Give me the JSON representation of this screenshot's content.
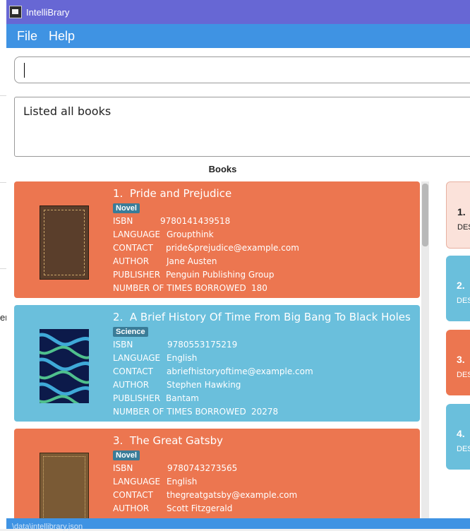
{
  "window": {
    "title": "IntelliBrary"
  },
  "menu": {
    "file": "File",
    "help": "Help"
  },
  "command": {
    "value": "",
    "placeholder": ""
  },
  "result": {
    "text": "Listed all books"
  },
  "books_panel": {
    "header": "Books"
  },
  "underlay": {
    "fragment": "er"
  },
  "books": [
    {
      "index": "1.",
      "title": "Pride and Prejudice",
      "tag": "Novel",
      "card_color": "#ec7650",
      "fields": [
        {
          "label": "ISBN",
          "value": "9780141439518"
        },
        {
          "label": "LANGUAGE",
          "value": "Groupthink"
        },
        {
          "label": "CONTACT",
          "value": "pride&prejudice@example.com"
        },
        {
          "label": "AUTHOR",
          "value": "Jane Austen"
        },
        {
          "label": "PUBLISHER",
          "value": "Penguin Publishing Group"
        },
        {
          "label": "NUMBER OF TIMES BORROWED",
          "value": "180"
        }
      ]
    },
    {
      "index": "2.",
      "title": "A Brief History Of Time From Big Bang To Black Holes",
      "tag": "Science",
      "card_color": "#6abfdc",
      "fields": [
        {
          "label": "ISBN",
          "value": "9780553175219"
        },
        {
          "label": "LANGUAGE",
          "value": "English"
        },
        {
          "label": "CONTACT",
          "value": "abriefhistoryoftime@example.com"
        },
        {
          "label": "AUTHOR",
          "value": "Stephen Hawking"
        },
        {
          "label": "PUBLISHER",
          "value": "Bantam"
        },
        {
          "label": "NUMBER OF TIMES BORROWED",
          "value": "20278"
        }
      ]
    },
    {
      "index": "3.",
      "title": "The Great Gatsby",
      "tag": "Novel",
      "card_color": "#ec7650",
      "fields": [
        {
          "label": "ISBN",
          "value": "9780743273565"
        },
        {
          "label": "LANGUAGE",
          "value": "English"
        },
        {
          "label": "CONTACT",
          "value": "thegreatgatsby@example.com"
        },
        {
          "label": "AUTHOR",
          "value": "Scott Fitzgerald"
        }
      ]
    }
  ],
  "side_panel": [
    {
      "num": "1.",
      "des": "DES",
      "color": "#fbe2da"
    },
    {
      "num": "2.",
      "des": "DES",
      "color": "#6abfdc"
    },
    {
      "num": "3.",
      "des": "DES",
      "color": "#ec7650"
    },
    {
      "num": "4.",
      "des": "DES",
      "color": "#6abfdc"
    }
  ],
  "status": {
    "path": "\\data\\intellibrary.json"
  }
}
